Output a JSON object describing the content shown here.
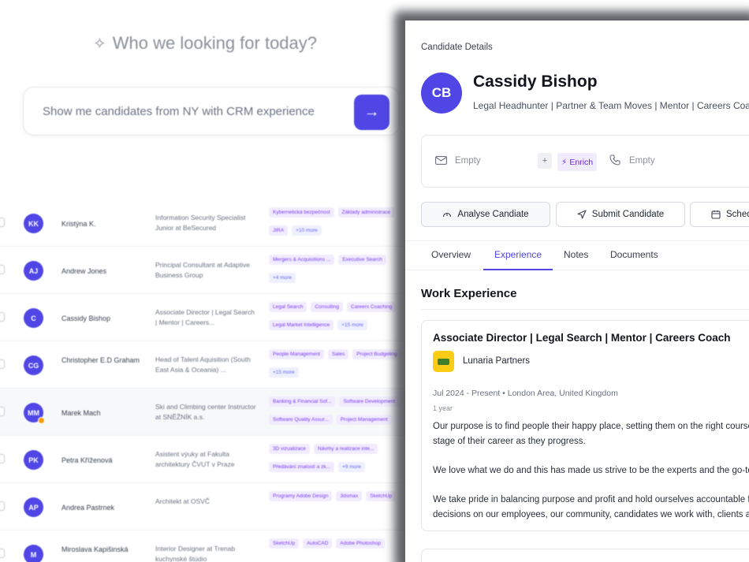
{
  "search": {
    "title": "Who we looking for today?",
    "placeholder": "Show me candidates from NY with CRM experience"
  },
  "rows": [
    {
      "initials": "KK",
      "name": "Kristýna K.",
      "role": "Information Security Specialist Junior at BeSecured",
      "tags": [
        "Kybernetická bezpečnost",
        "Základy administrace"
      ],
      "tags2": [
        "JIRA"
      ],
      "more": "+10 more",
      "highlight": false
    },
    {
      "initials": "AJ",
      "name": "Andrew Jones",
      "role": "Principal Consultant at Adaptive Business Group",
      "tags": [
        "Mergers & Acquisitions ...",
        "Executive Search"
      ],
      "tags2": [],
      "more": "+4 more",
      "highlight": false
    },
    {
      "initials": "C",
      "name": "Cassidy Bishop",
      "role": "Associate Director | Legal Search | Mentor | Careers...",
      "tags": [
        "Legal Search",
        "Consulting",
        "Careers Coaching"
      ],
      "tags2": [
        "Legal Market Intelligence"
      ],
      "more": "+15 more",
      "highlight": false
    },
    {
      "initials": "CG",
      "name": "Christopher E.D Graham",
      "role": "Head of Talent Aquisition (South East Asia & Oceania) ...",
      "tags": [
        "People Management",
        "Sales",
        "Project Budgeting"
      ],
      "tags2": [],
      "more": "+15 more",
      "highlight": false
    },
    {
      "initials": "MM",
      "name": "Marek Mach",
      "role": "Ski and Climbing center Instructor at SNĚŽNÍK a.s.",
      "tags": [
        "Banking & Financial Sof...",
        "Software Development"
      ],
      "tags2": [
        "Software Quality Assur...",
        "Project Management"
      ],
      "more": "",
      "highlight": true
    },
    {
      "initials": "PK",
      "name": "Petra Kříženová",
      "role": "Asistent výuky at Fakulta architektury ČVUT v Praze",
      "tags": [
        "3D vizualizace",
        "Návrhy a realizace inte..."
      ],
      "tags2": [
        "Předávání znalostí a zk..."
      ],
      "more": "+9 more",
      "highlight": false
    },
    {
      "initials": "AP",
      "name": "Andrea Pastrnek",
      "role": "Architekt at OSVČ",
      "tags": [
        "Programy Adobe Design",
        "3dsmax",
        "SketchUp"
      ],
      "tags2": [],
      "more": "",
      "highlight": false
    },
    {
      "initials": "M",
      "name": "Miroslava Kapišinská",
      "role": "Interior Designer at Trenab kuchynské štúdio",
      "tags": [
        "SketchUp",
        "AutoCAD",
        "Adobe Photoshop"
      ],
      "tags2": [],
      "more": "",
      "highlight": false
    }
  ],
  "panel": {
    "label": "Candidate Details",
    "initials": "CB",
    "name": "Cassidy Bishop",
    "headline": "Legal Headhunter | Partner & Team Moves | Mentor | Careers Coach",
    "email": "Empty",
    "phone": "Empty",
    "plus": "+",
    "enrich": "Enrich",
    "actions": {
      "analyse": "Analyse Candiate",
      "submit": "Submit Candidate",
      "schedule": "Schedule"
    },
    "tabs": [
      "Overview",
      "Experience",
      "Notes",
      "Documents"
    ],
    "section": "Work Experience",
    "experience": {
      "title": "Associate Director | Legal Search | Mentor | Careers Coach",
      "company": "Lunaria Partners",
      "period": "Jul 2024 - Present • London Area, United Kingdom",
      "duration": "1 year",
      "desc": [
        "Our purpose is to find people their happy place, setting them on the right course at every",
        "stage of their career as they progress.",
        "We love what we do and this has made us strive to be the experts and the go-to firm.",
        "We take pride in balancing purpose and profit and hold ourselves accountable for our",
        "decisions on our employees, our community, candidates we work with, clients and partners."
      ]
    }
  },
  "colors": {
    "accent": "#4f46e5",
    "tag_bg": "#f1ecfd",
    "tag_text": "#7c3aed"
  }
}
